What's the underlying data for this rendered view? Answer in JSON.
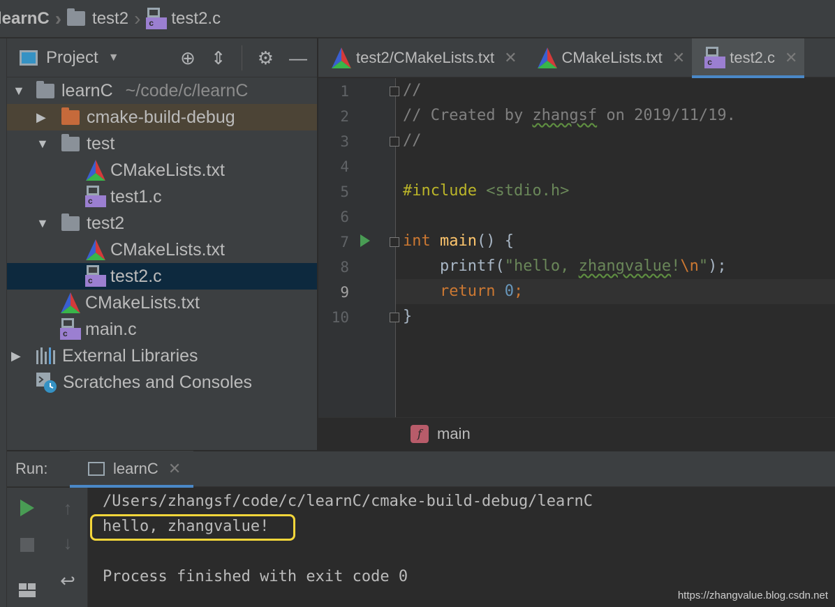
{
  "breadcrumb": {
    "items": [
      "learnC",
      "test2",
      "test2.c"
    ]
  },
  "project_panel": {
    "title": "Project",
    "tree": [
      {
        "label": "learnC",
        "path": "~/code/c/learnC",
        "icon": "folder-icon"
      },
      {
        "label": "cmake-build-debug",
        "icon": "folder-excluded-icon"
      },
      {
        "label": "test",
        "icon": "folder-icon"
      },
      {
        "label": "CMakeLists.txt",
        "icon": "cmake-icon"
      },
      {
        "label": "test1.c",
        "icon": "c-file-icon"
      },
      {
        "label": "test2",
        "icon": "folder-icon"
      },
      {
        "label": "CMakeLists.txt",
        "icon": "cmake-icon"
      },
      {
        "label": "test2.c",
        "icon": "c-file-icon",
        "selected": true
      },
      {
        "label": "CMakeLists.txt",
        "icon": "cmake-icon"
      },
      {
        "label": "main.c",
        "icon": "c-file-icon"
      },
      {
        "label": "External Libraries",
        "icon": "library-icon"
      },
      {
        "label": "Scratches and Consoles",
        "icon": "scratches-icon"
      }
    ]
  },
  "tabs": [
    {
      "label": "test2/CMakeLists.txt",
      "close": "✕"
    },
    {
      "label": "CMakeLists.txt",
      "close": "✕"
    },
    {
      "label": "test2.c",
      "close": "✕",
      "active": true
    }
  ],
  "editor": {
    "line_numbers": [
      "1",
      "2",
      "3",
      "4",
      "5",
      "6",
      "7",
      "8",
      "9",
      "10"
    ],
    "code": {
      "l1": "//",
      "l2a": "// Created by ",
      "l2b": "zhangsf",
      "l2c": " on 2019/11/19.",
      "l3": "//",
      "l5a": "#include",
      "l5b": " <stdio.h>",
      "l7a": "int",
      "l7b": " ",
      "l7c": "main",
      "l7d": "() {",
      "l8a": "    printf(",
      "l8b": "\"hello, ",
      "l8c": "zhangvalue",
      "l8d": "!",
      "l8e": "\\n",
      "l8f": "\"",
      "l8g": ");",
      "l9a": "    ",
      "l9b": "return",
      "l9c": " ",
      "l9d": "0",
      "l9e": ";",
      "l10": "}"
    },
    "current_line": "9",
    "footer_function": "main"
  },
  "run_panel": {
    "label": "Run:",
    "tab": "learnC",
    "tab_close": "✕",
    "output": [
      "/Users/zhangsf/code/c/learnC/cmake-build-debug/learnC",
      "hello, zhangvalue!",
      "",
      "Process finished with exit code 0"
    ]
  },
  "watermark": "https://zhangvalue.blog.csdn.net",
  "colors": {
    "accent": "#4a88c7",
    "highlight_box": "#f4d63a",
    "run_green": "#499c54"
  }
}
